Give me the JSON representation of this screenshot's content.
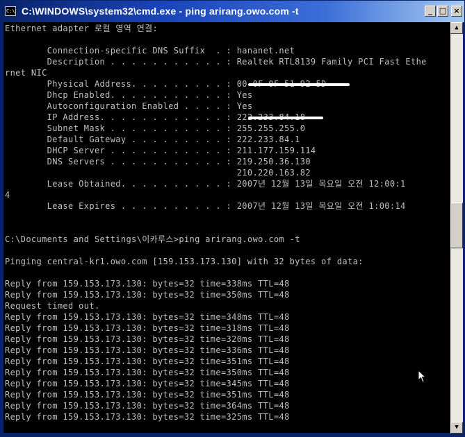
{
  "window": {
    "title": "C:\\WINDOWS\\system32\\cmd.exe - ping arirang.owo.com -t",
    "icon_label": "C:\\",
    "controls": {
      "minimize": "_",
      "maximize": "□",
      "close": "×"
    }
  },
  "console": {
    "lines": [
      "Ethernet adapter 로컬 영역 연결:",
      "",
      "        Connection-specific DNS Suffix  . : hananet.net",
      "        Description . . . . . . . . . . . : Realtek RTL8139 Family PCI Fast Ethe",
      "rnet NIC",
      "        Physical Address. . . . . . . . . : 00-0F-0F-51-92-5D",
      "        Dhcp Enabled. . . . . . . . . . . : Yes",
      "        Autoconfiguration Enabled . . . . : Yes",
      "        IP Address. . . . . . . . . . . . : 222.233.84.18",
      "        Subnet Mask . . . . . . . . . . . : 255.255.255.0",
      "        Default Gateway . . . . . . . . . : 222.233.84.1",
      "        DHCP Server . . . . . . . . . . . : 211.177.159.114",
      "        DNS Servers . . . . . . . . . . . : 219.250.36.130",
      "                                            210.220.163.82",
      "        Lease Obtained. . . . . . . . . . : 2007년 12월 13일 목요일 오전 12:00:1",
      "4",
      "        Lease Expires . . . . . . . . . . : 2007년 12월 13일 목요일 오전 1:00:14",
      "",
      "",
      "C:\\Documents and Settings\\이카루스>ping arirang.owo.com -t",
      "",
      "Pinging central-kr1.owo.com [159.153.173.130] with 32 bytes of data:",
      "",
      "Reply from 159.153.173.130: bytes=32 time=338ms TTL=48",
      "Reply from 159.153.173.130: bytes=32 time=350ms TTL=48",
      "Request timed out.",
      "Reply from 159.153.173.130: bytes=32 time=348ms TTL=48",
      "Reply from 159.153.173.130: bytes=32 time=318ms TTL=48",
      "Reply from 159.153.173.130: bytes=32 time=320ms TTL=48",
      "Reply from 159.153.173.130: bytes=32 time=336ms TTL=48",
      "Reply from 159.153.173.130: bytes=32 time=351ms TTL=48",
      "Reply from 159.153.173.130: bytes=32 time=350ms TTL=48",
      "Reply from 159.153.173.130: bytes=32 time=345ms TTL=48",
      "Reply from 159.153.173.130: bytes=32 time=351ms TTL=48",
      "Reply from 159.153.173.130: bytes=32 time=364ms TTL=48",
      "Reply from 159.153.173.130: bytes=32 time=325ms TTL=48"
    ]
  },
  "colors": {
    "title_bar": "#0a246a",
    "console_background": "#000000",
    "console_text": "#c0c0c0"
  }
}
